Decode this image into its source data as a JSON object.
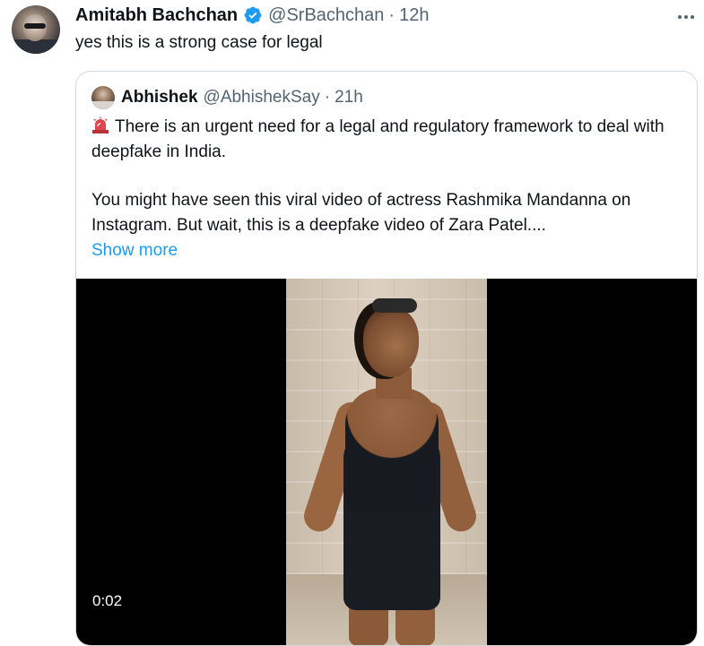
{
  "tweet": {
    "author_name": "Amitabh Bachchan",
    "handle": "@SrBachchan",
    "separator": "·",
    "time": "12h",
    "text": "yes this is a strong case for legal",
    "verified_color": "#1d9bf0"
  },
  "quoted": {
    "author_name": "Abhishek",
    "handle": "@AbhishekSay",
    "separator": "·",
    "time": "21h",
    "emoji_icon": "police-siren-icon",
    "paragraph1": "There is an urgent need for a legal and regulatory framework to deal with deepfake in India.",
    "paragraph2": "You might have seen this viral video of actress Rashmika Mandanna on Instagram. But wait, this is a deepfake video of Zara Patel....",
    "show_more": "Show more",
    "video": {
      "timestamp": "0:02"
    }
  },
  "colors": {
    "text": "#0f1419",
    "muted": "#536471",
    "link": "#1d9bf0",
    "border": "#cfd9de"
  }
}
